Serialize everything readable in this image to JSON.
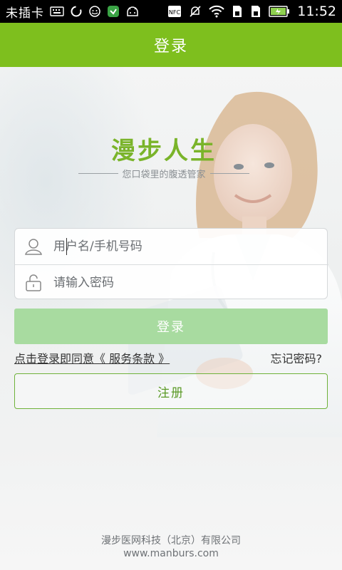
{
  "status_bar": {
    "carrier": "未插卡",
    "time": "11:52",
    "nfc_label": "NFC",
    "icons": [
      "keyboard-icon",
      "sync-icon",
      "face-icon",
      "shield-icon",
      "android-icon",
      "nfc-icon",
      "mute-icon",
      "wifi-icon",
      "sim-icon",
      "sim2-icon",
      "battery-icon"
    ]
  },
  "header": {
    "title": "登录"
  },
  "branding": {
    "app_name": "漫步人生",
    "tagline": "您口袋里的腹透管家",
    "brand_color": "#7ab42a"
  },
  "form": {
    "username_placeholder": "用户名/手机号码",
    "password_placeholder": "请输入密码",
    "login_label": "登录",
    "agreement_text": "点击登录即同意《 服务条款 》",
    "forgot_label": "忘记密码?",
    "register_label": "注册"
  },
  "footer": {
    "company": "漫步医网科技（北京）有限公司",
    "website": "www.manburs.com"
  },
  "colors": {
    "header_bg": "#7ebf1e",
    "login_button_bg": "#a8dba0",
    "register_border": "#6fb23a"
  }
}
